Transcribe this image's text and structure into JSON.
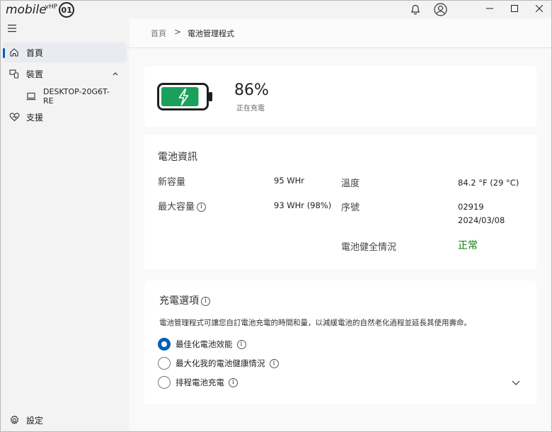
{
  "titlebar": {
    "logo_text": "mobile",
    "logo_sup": "vHP",
    "logo_circle": "01"
  },
  "sidebar": {
    "items": [
      {
        "label": "首頁",
        "icon": "home-icon"
      },
      {
        "label": "裝置",
        "icon": "devices-icon"
      },
      {
        "label": "支援",
        "icon": "support-icon"
      }
    ],
    "device": {
      "label": "DESKTOP-20G6T-RE",
      "icon": "laptop-icon"
    },
    "settings": {
      "label": "設定",
      "icon": "gear-icon"
    }
  },
  "breadcrumb": {
    "home": "首頁",
    "separator": ">",
    "current": "電池管理程式"
  },
  "battery": {
    "percent": "86%",
    "status": "正在充電",
    "level": 0.86,
    "color": "#1aa05a"
  },
  "battery_info": {
    "title": "電池資訊",
    "new_capacity_label": "新容量",
    "new_capacity_value": "95 WHr",
    "max_capacity_label": "最大容量",
    "max_capacity_value": "93 WHr (98%)",
    "temperature_label": "溫度",
    "temperature_value": "84.2 °F (29 °C)",
    "serial_label": "序號",
    "serial_value": "02919",
    "serial_date": "2024/03/08",
    "health_label": "電池健全情況",
    "health_value": "正常"
  },
  "charging_options": {
    "title": "充電選項",
    "description": "電池管理程式可讓您自訂電池充電的時間和量，以減緩電池的自然老化過程並延長其使用壽命。",
    "options": [
      {
        "label": "最佳化電池效能",
        "selected": true
      },
      {
        "label": "最大化我的電池健康情況",
        "selected": false
      },
      {
        "label": "排程電池充電",
        "selected": false
      }
    ]
  },
  "colors": {
    "accent": "#005fb8",
    "health_ok": "#0f7b0f"
  }
}
